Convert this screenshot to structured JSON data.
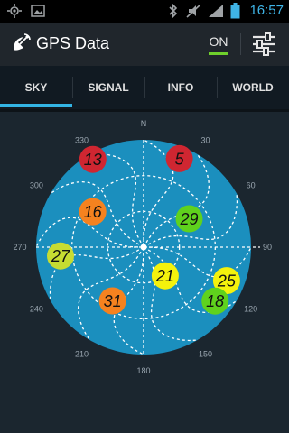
{
  "status_bar": {
    "time": "16:57",
    "icons_left": [
      "gps-icon",
      "image-icon"
    ],
    "icons_right": [
      "bluetooth-icon",
      "silent-icon",
      "signal-icon",
      "battery-icon"
    ]
  },
  "action_bar": {
    "title": "GPS Data",
    "toggle_label": "ON",
    "app_icon": "satellite-icon",
    "settings_icon": "sliders-icon"
  },
  "tabs": [
    {
      "label": "SKY",
      "active": true
    },
    {
      "label": "SIGNAL",
      "active": false
    },
    {
      "label": "INFO",
      "active": false
    },
    {
      "label": "WORLD",
      "active": false
    }
  ],
  "sky": {
    "north_label": "N",
    "degree_labels": [
      "30",
      "60",
      "90",
      "120",
      "150",
      "180",
      "210",
      "240",
      "270",
      "300",
      "330"
    ],
    "elevation_rings": [
      30,
      60
    ],
    "colors": {
      "dish": "#1b8fbe",
      "background": "#1b262f",
      "red": "#cf2631",
      "orange": "#f5821f",
      "yellow_green": "#c6dc32",
      "green": "#5fd21d",
      "yellow": "#f4f20c"
    },
    "satellites": [
      {
        "prn": "5",
        "azimuth": 22,
        "elevation": 10,
        "color": "#cf2631"
      },
      {
        "prn": "13",
        "azimuth": 330,
        "elevation": 5,
        "color": "#cf2631"
      },
      {
        "prn": "16",
        "azimuth": 305,
        "elevation": 38,
        "color": "#f5821f"
      },
      {
        "prn": "29",
        "azimuth": 58,
        "elevation": 45,
        "color": "#5fd21d"
      },
      {
        "prn": "27",
        "azimuth": 264,
        "elevation": 20,
        "color": "#c6dc32"
      },
      {
        "prn": "21",
        "azimuth": 143,
        "elevation": 60,
        "color": "#f4f20c"
      },
      {
        "prn": "25",
        "azimuth": 112,
        "elevation": 15,
        "color": "#f4f20c"
      },
      {
        "prn": "31",
        "azimuth": 210,
        "elevation": 38,
        "color": "#f5821f"
      },
      {
        "prn": "18",
        "azimuth": 127,
        "elevation": 15,
        "color": "#5fd21d"
      }
    ]
  }
}
